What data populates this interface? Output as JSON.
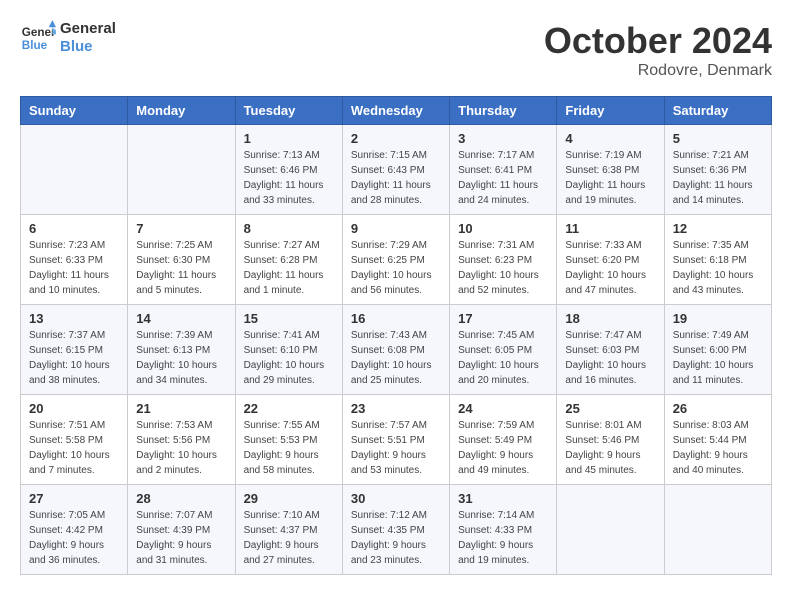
{
  "header": {
    "logo_line1": "General",
    "logo_line2": "Blue",
    "month": "October 2024",
    "location": "Rodovre, Denmark"
  },
  "days_of_week": [
    "Sunday",
    "Monday",
    "Tuesday",
    "Wednesday",
    "Thursday",
    "Friday",
    "Saturday"
  ],
  "weeks": [
    [
      {
        "day": "",
        "info": ""
      },
      {
        "day": "",
        "info": ""
      },
      {
        "day": "1",
        "info": "Sunrise: 7:13 AM\nSunset: 6:46 PM\nDaylight: 11 hours\nand 33 minutes."
      },
      {
        "day": "2",
        "info": "Sunrise: 7:15 AM\nSunset: 6:43 PM\nDaylight: 11 hours\nand 28 minutes."
      },
      {
        "day": "3",
        "info": "Sunrise: 7:17 AM\nSunset: 6:41 PM\nDaylight: 11 hours\nand 24 minutes."
      },
      {
        "day": "4",
        "info": "Sunrise: 7:19 AM\nSunset: 6:38 PM\nDaylight: 11 hours\nand 19 minutes."
      },
      {
        "day": "5",
        "info": "Sunrise: 7:21 AM\nSunset: 6:36 PM\nDaylight: 11 hours\nand 14 minutes."
      }
    ],
    [
      {
        "day": "6",
        "info": "Sunrise: 7:23 AM\nSunset: 6:33 PM\nDaylight: 11 hours\nand 10 minutes."
      },
      {
        "day": "7",
        "info": "Sunrise: 7:25 AM\nSunset: 6:30 PM\nDaylight: 11 hours\nand 5 minutes."
      },
      {
        "day": "8",
        "info": "Sunrise: 7:27 AM\nSunset: 6:28 PM\nDaylight: 11 hours\nand 1 minute."
      },
      {
        "day": "9",
        "info": "Sunrise: 7:29 AM\nSunset: 6:25 PM\nDaylight: 10 hours\nand 56 minutes."
      },
      {
        "day": "10",
        "info": "Sunrise: 7:31 AM\nSunset: 6:23 PM\nDaylight: 10 hours\nand 52 minutes."
      },
      {
        "day": "11",
        "info": "Sunrise: 7:33 AM\nSunset: 6:20 PM\nDaylight: 10 hours\nand 47 minutes."
      },
      {
        "day": "12",
        "info": "Sunrise: 7:35 AM\nSunset: 6:18 PM\nDaylight: 10 hours\nand 43 minutes."
      }
    ],
    [
      {
        "day": "13",
        "info": "Sunrise: 7:37 AM\nSunset: 6:15 PM\nDaylight: 10 hours\nand 38 minutes."
      },
      {
        "day": "14",
        "info": "Sunrise: 7:39 AM\nSunset: 6:13 PM\nDaylight: 10 hours\nand 34 minutes."
      },
      {
        "day": "15",
        "info": "Sunrise: 7:41 AM\nSunset: 6:10 PM\nDaylight: 10 hours\nand 29 minutes."
      },
      {
        "day": "16",
        "info": "Sunrise: 7:43 AM\nSunset: 6:08 PM\nDaylight: 10 hours\nand 25 minutes."
      },
      {
        "day": "17",
        "info": "Sunrise: 7:45 AM\nSunset: 6:05 PM\nDaylight: 10 hours\nand 20 minutes."
      },
      {
        "day": "18",
        "info": "Sunrise: 7:47 AM\nSunset: 6:03 PM\nDaylight: 10 hours\nand 16 minutes."
      },
      {
        "day": "19",
        "info": "Sunrise: 7:49 AM\nSunset: 6:00 PM\nDaylight: 10 hours\nand 11 minutes."
      }
    ],
    [
      {
        "day": "20",
        "info": "Sunrise: 7:51 AM\nSunset: 5:58 PM\nDaylight: 10 hours\nand 7 minutes."
      },
      {
        "day": "21",
        "info": "Sunrise: 7:53 AM\nSunset: 5:56 PM\nDaylight: 10 hours\nand 2 minutes."
      },
      {
        "day": "22",
        "info": "Sunrise: 7:55 AM\nSunset: 5:53 PM\nDaylight: 9 hours\nand 58 minutes."
      },
      {
        "day": "23",
        "info": "Sunrise: 7:57 AM\nSunset: 5:51 PM\nDaylight: 9 hours\nand 53 minutes."
      },
      {
        "day": "24",
        "info": "Sunrise: 7:59 AM\nSunset: 5:49 PM\nDaylight: 9 hours\nand 49 minutes."
      },
      {
        "day": "25",
        "info": "Sunrise: 8:01 AM\nSunset: 5:46 PM\nDaylight: 9 hours\nand 45 minutes."
      },
      {
        "day": "26",
        "info": "Sunrise: 8:03 AM\nSunset: 5:44 PM\nDaylight: 9 hours\nand 40 minutes."
      }
    ],
    [
      {
        "day": "27",
        "info": "Sunrise: 7:05 AM\nSunset: 4:42 PM\nDaylight: 9 hours\nand 36 minutes."
      },
      {
        "day": "28",
        "info": "Sunrise: 7:07 AM\nSunset: 4:39 PM\nDaylight: 9 hours\nand 31 minutes."
      },
      {
        "day": "29",
        "info": "Sunrise: 7:10 AM\nSunset: 4:37 PM\nDaylight: 9 hours\nand 27 minutes."
      },
      {
        "day": "30",
        "info": "Sunrise: 7:12 AM\nSunset: 4:35 PM\nDaylight: 9 hours\nand 23 minutes."
      },
      {
        "day": "31",
        "info": "Sunrise: 7:14 AM\nSunset: 4:33 PM\nDaylight: 9 hours\nand 19 minutes."
      },
      {
        "day": "",
        "info": ""
      },
      {
        "day": "",
        "info": ""
      }
    ]
  ]
}
